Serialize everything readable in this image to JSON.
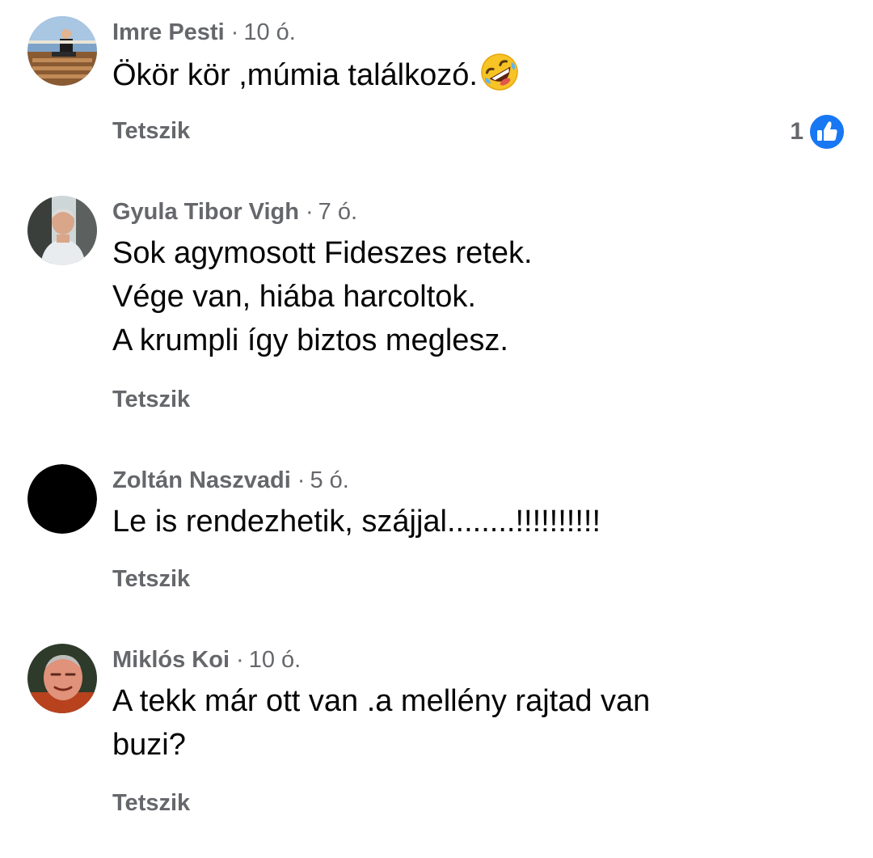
{
  "colors": {
    "meta_gray": "#65676b",
    "text": "#050505",
    "like_blue": "#1877f2",
    "background": "#ffffff"
  },
  "comments": [
    {
      "author": "Imre Pesti",
      "separator": "·",
      "time": "10 ó.",
      "lines": [
        "Ökör kör ,múmia találkozó."
      ],
      "emoji": "rolling-on-floor-laughing-emoji",
      "like_label": "Tetszik",
      "reaction_count": "1",
      "reaction_icon": "thumbs-up-icon"
    },
    {
      "author": "Gyula Tibor Vigh",
      "separator": "·",
      "time": "7 ó.",
      "lines": [
        "Sok agymosott Fideszes retek.",
        "Vége van, hiába harcoltok.",
        "A krumpli így biztos meglesz."
      ],
      "like_label": "Tetszik"
    },
    {
      "author": "Zoltán Naszvadi",
      "separator": "·",
      "time": "5 ó.",
      "lines": [
        "Le is rendezhetik, szájjal........!!!!!!!!!!"
      ],
      "like_label": "Tetszik"
    },
    {
      "author": "Miklós Koi",
      "separator": "·",
      "time": "10 ó.",
      "lines": [
        "A tekk már ott van .a mellény rajtad van",
        "buzi?"
      ],
      "like_label": "Tetszik"
    }
  ]
}
